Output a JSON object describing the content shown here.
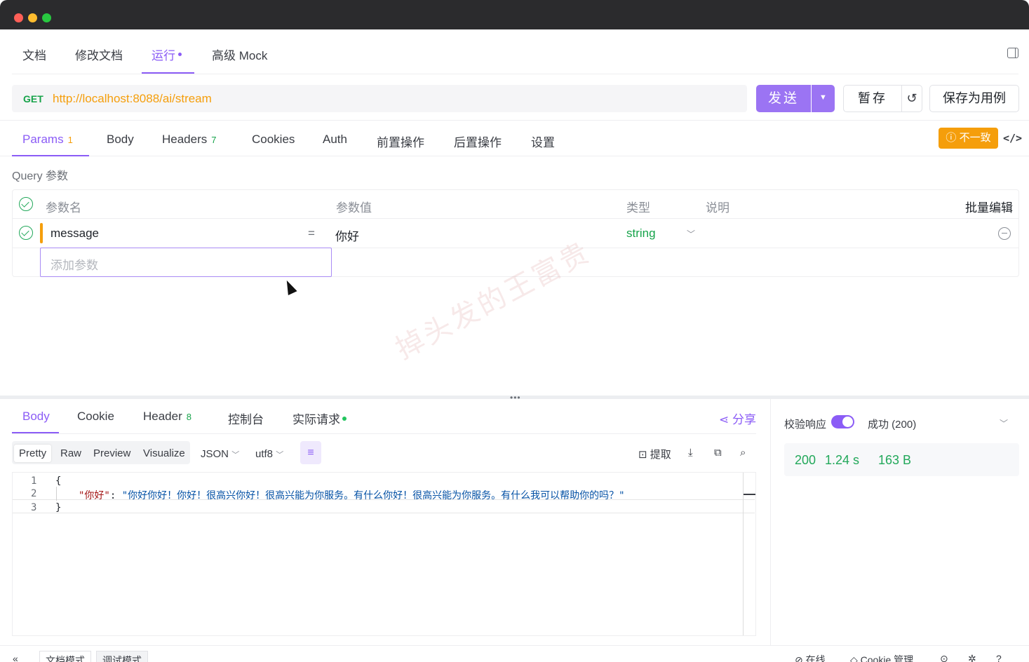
{
  "top_tabs": [
    {
      "label": "文档"
    },
    {
      "label": "修改文档"
    },
    {
      "label": "运行"
    },
    {
      "label": "高级 Mock"
    }
  ],
  "request": {
    "method": "GET",
    "url": "http://localhost:8088/ai/stream",
    "send_label": "发送",
    "stash_label": "暂存",
    "save_case_label": "保存为用例"
  },
  "req_tabs": [
    {
      "label": "Params",
      "badge": "1"
    },
    {
      "label": "Body"
    },
    {
      "label": "Headers",
      "badge": "7"
    },
    {
      "label": "Cookies"
    },
    {
      "label": "Auth"
    },
    {
      "label": "前置操作"
    },
    {
      "label": "后置操作"
    },
    {
      "label": "设置"
    }
  ],
  "mismatch_label": "不一致",
  "query": {
    "title": "Query 参数",
    "headers": {
      "name": "参数名",
      "value": "参数值",
      "type": "类型",
      "desc": "说明",
      "bulk": "批量编辑"
    },
    "rows": [
      {
        "name": "message",
        "eq": "=",
        "value": "你好",
        "type": "string"
      }
    ],
    "add_placeholder": "添加参数"
  },
  "watermark": "掉头发的王富贵",
  "response": {
    "tabs": [
      {
        "label": "Body"
      },
      {
        "label": "Cookie"
      },
      {
        "label": "Header",
        "badge": "8"
      },
      {
        "label": "控制台"
      },
      {
        "label": "实际请求"
      }
    ],
    "share_label": "分享",
    "views": [
      "Pretty",
      "Raw",
      "Preview",
      "Visualize"
    ],
    "format": "JSON",
    "encoding": "utf8",
    "extract_label": "提取",
    "lines": [
      "1",
      "2",
      "3"
    ],
    "code": {
      "open": "{",
      "key": "\"你好\"",
      "colon": ": ",
      "value": "\"你好你好！你好！很高兴你好！很高兴能为你服务。有什么你好！很高兴能为你服务。有什么我可以帮助你的吗？\"",
      "close": "}"
    }
  },
  "validation": {
    "label": "校验响应",
    "enabled": true,
    "result": "成功 (200)"
  },
  "stats": {
    "status": "200",
    "time": "1.24 s",
    "size": "163 B"
  },
  "bottom": {
    "doc_mode": "文档模式",
    "debug_mode": "调试模式",
    "online": "在线",
    "cookie_mgmt": "Cookie 管理"
  },
  "colors": {
    "accent": "#8b5cf6",
    "success": "#22a85a",
    "warning": "#f59e0b",
    "method_get": "#17a34a"
  }
}
